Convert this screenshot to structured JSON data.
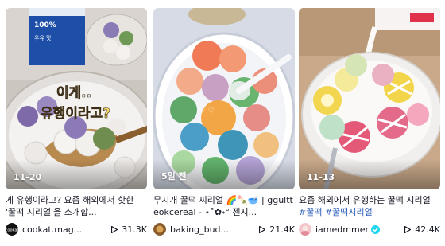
{
  "videos": [
    {
      "date": "11-20",
      "overlay_text": "이게..\n유행이라고?",
      "caption": "게 유행이라고? 요즘 해외에서 핫한 '꿀떡 시리얼'을 소개합...",
      "username": "cookat.mag...",
      "views": "31.3K",
      "verified": false
    },
    {
      "date": "5일 전",
      "caption": "무지개 꿀떡 씨리얼 🌈🍡🥣 | ggultteokcereal - ⋆˚✿˖° 젠지...",
      "username": "baking_bud...",
      "views": "21.4K",
      "verified": false
    },
    {
      "date": "11-13",
      "caption_text": "요즘 해외에서 유행하는 꿀떡 시리얼 ",
      "caption_tags": "#꿀떡 #꿀떡시리얼",
      "username": "iamedmmer",
      "views": "42.4K",
      "verified": true
    }
  ],
  "icons": {
    "play": "play-icon",
    "verified": "verified-badge-icon"
  },
  "colors": {
    "tag": "#2b5db9",
    "verified": "#20d5ec"
  }
}
